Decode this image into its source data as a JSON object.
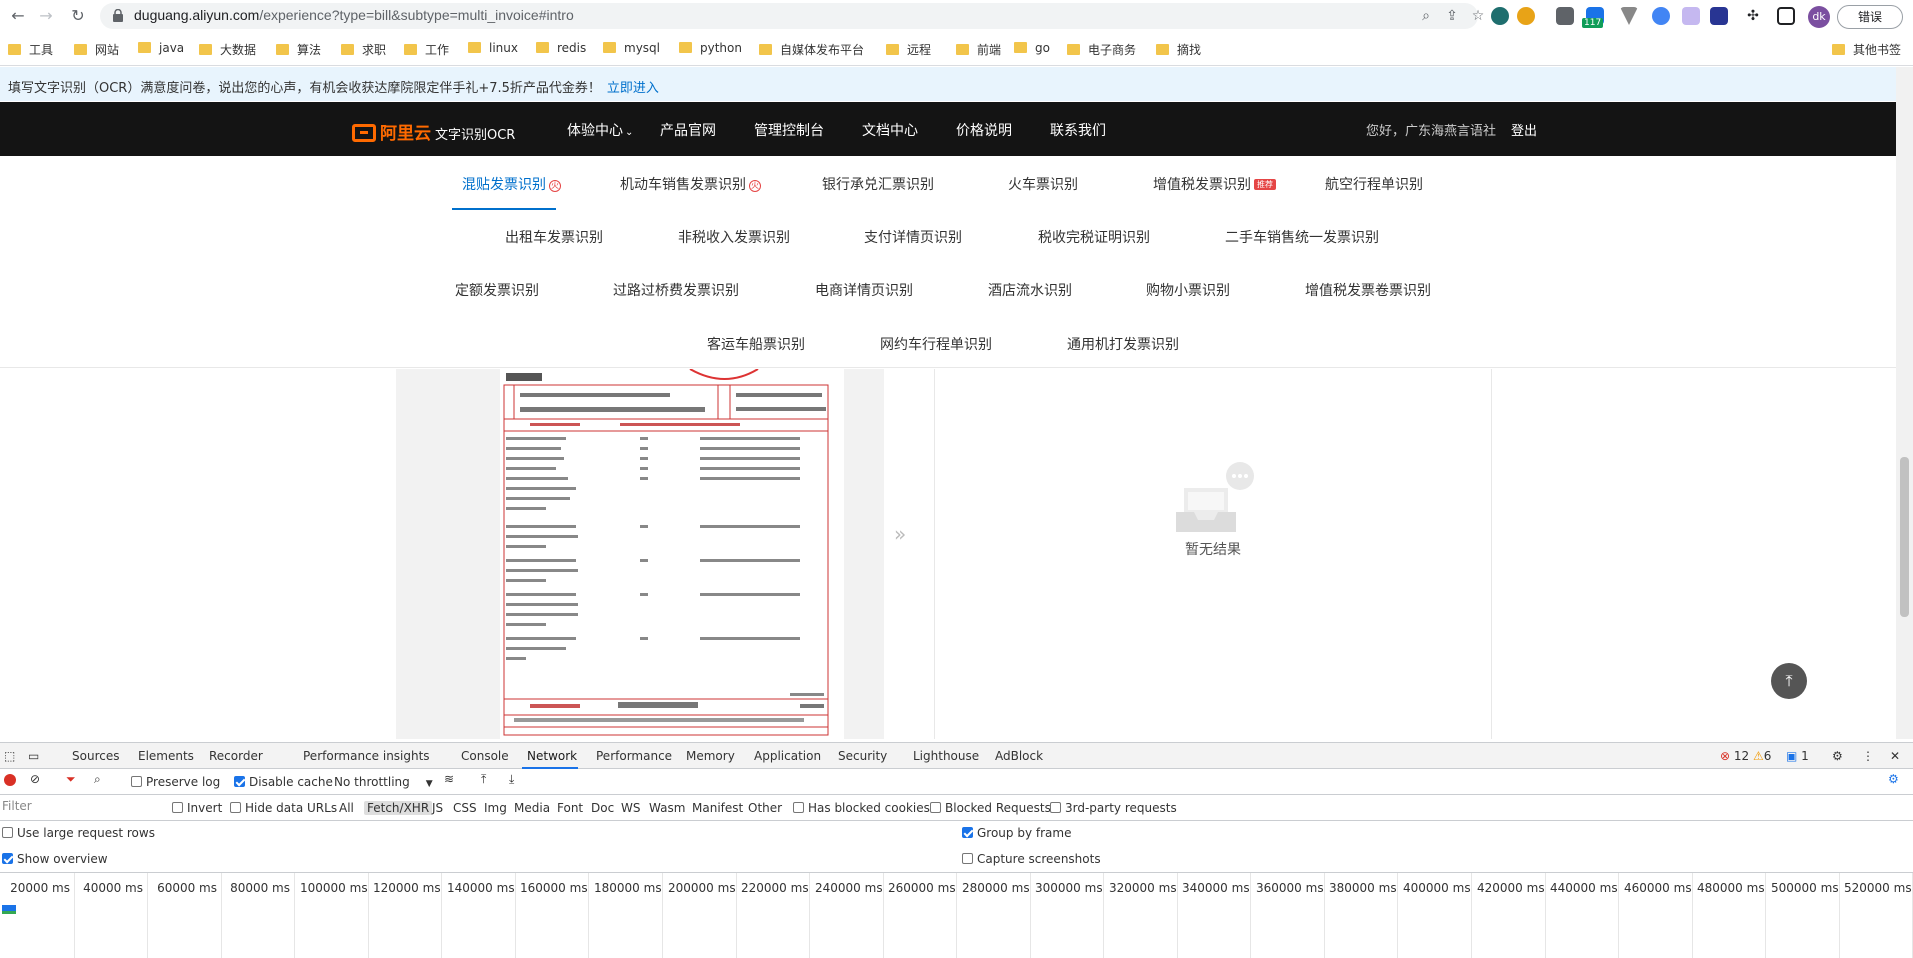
{
  "browser": {
    "url_host": "duguang.aliyun.com",
    "url_path": "/experience?type=bill&subtype=multi_invoice#intro",
    "extension_badge": "117",
    "profile_initials": "dk",
    "error_button": "错误"
  },
  "bookmarks": {
    "items": [
      "工具",
      "网站",
      "java",
      "大数据",
      "算法",
      "求职",
      "工作",
      "linux",
      "redis",
      "mysql",
      "python",
      "自媒体发布平台",
      "远程",
      "前端",
      "go",
      "电子商务",
      "摘找"
    ],
    "other": "其他书签"
  },
  "notice": {
    "text": "填写文字识别（OCR）满意度问卷，说出您的心声，有机会收获达摩院限定伴手礼+7.5折产品代金券！",
    "link": "立即进入"
  },
  "topnav": {
    "brand": "阿里云",
    "product": "文字识别OCR",
    "items": [
      "体验中心",
      "产品官网",
      "管理控制台",
      "文档中心",
      "价格说明",
      "联系我们"
    ],
    "greeting": "您好，广东海燕言语社",
    "logout": "登出"
  },
  "tabs": {
    "row1": [
      "混贴发票识别",
      "机动车销售发票识别",
      "银行承兑汇票识别",
      "火车票识别",
      "增值税发票识别",
      "航空行程单识别"
    ],
    "row2": [
      "出租车发票识别",
      "非税收入发票识别",
      "支付详情页识别",
      "税收完税证明识别",
      "二手车销售统一发票识别"
    ],
    "row3": [
      "定额发票识别",
      "过路过桥费发票识别",
      "电商详情页识别",
      "酒店流水识别",
      "购物小票识别",
      "增值税发票卷票识别"
    ],
    "row4": [
      "客运车船票识别",
      "网约车行程单识别",
      "通用机打发票识别"
    ],
    "hot_icon": "火",
    "badge": "推荐"
  },
  "result": {
    "empty_text": "暂无结果"
  },
  "devtools": {
    "tabs": [
      "Sources",
      "Elements",
      "Recorder",
      "Performance insights",
      "Console",
      "Network",
      "Performance",
      "Memory",
      "Application",
      "Security",
      "Lighthouse",
      "AdBlock"
    ],
    "errors": "12",
    "warnings": "6",
    "messages": "1",
    "preserve_log": "Preserve log",
    "disable_cache": "Disable cache",
    "throttling": "No throttling",
    "filter_placeholder": "Filter",
    "filter_types": [
      "Invert",
      "Hide data URLs",
      "All",
      "Fetch/XHR",
      "JS",
      "CSS",
      "Img",
      "Media",
      "Font",
      "Doc",
      "WS",
      "Wasm",
      "Manifest",
      "Other"
    ],
    "has_blocked_cookies": "Has blocked cookies",
    "blocked_requests": "Blocked Requests",
    "third_party": "3rd-party requests",
    "use_large_rows": "Use large request rows",
    "show_overview": "Show overview",
    "group_by_frame": "Group by frame",
    "capture_screenshots": "Capture screenshots",
    "ticks": [
      "20000 ms",
      "40000 ms",
      "60000 ms",
      "80000 ms",
      "100000 ms",
      "120000 ms",
      "140000 ms",
      "160000 ms",
      "180000 ms",
      "200000 ms",
      "220000 ms",
      "240000 ms",
      "260000 ms",
      "280000 ms",
      "300000 ms",
      "320000 ms",
      "340000 ms",
      "360000 ms",
      "380000 ms",
      "400000 ms",
      "420000 ms",
      "440000 ms",
      "460000 ms",
      "480000 ms",
      "500000 ms",
      "520000 ms"
    ]
  }
}
